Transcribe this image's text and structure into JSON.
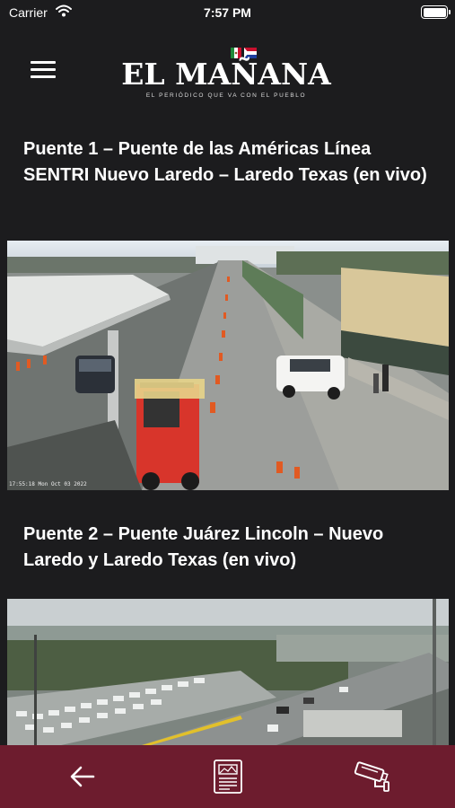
{
  "status_bar": {
    "carrier": "Carrier",
    "time": "7:57 PM",
    "battery_level": 1.0
  },
  "header": {
    "menu_icon": "hamburger-menu-icon",
    "logo_title": "EL MAÑANA",
    "logo_tagline": "EL PERIÓDICO QUE VA CON EL PUEBLO",
    "logo_flags": [
      "mexico",
      "tamaulipas"
    ]
  },
  "feeds": [
    {
      "title": "Puente 1 – Puente de las Américas Línea SENTRI Nuevo Laredo – Laredo Texas (en vivo)",
      "overlay_timestamp": "17:55:18 Mon Oct 03 2022"
    },
    {
      "title": "Puente 2 – Puente Juárez Lincoln – Nuevo Laredo y Laredo Texas (en vivo)"
    }
  ],
  "tab_bar": {
    "background": "#6d1c2e",
    "items": [
      {
        "icon": "back-arrow-icon"
      },
      {
        "icon": "newspaper-icon"
      },
      {
        "icon": "security-camera-icon"
      }
    ]
  }
}
